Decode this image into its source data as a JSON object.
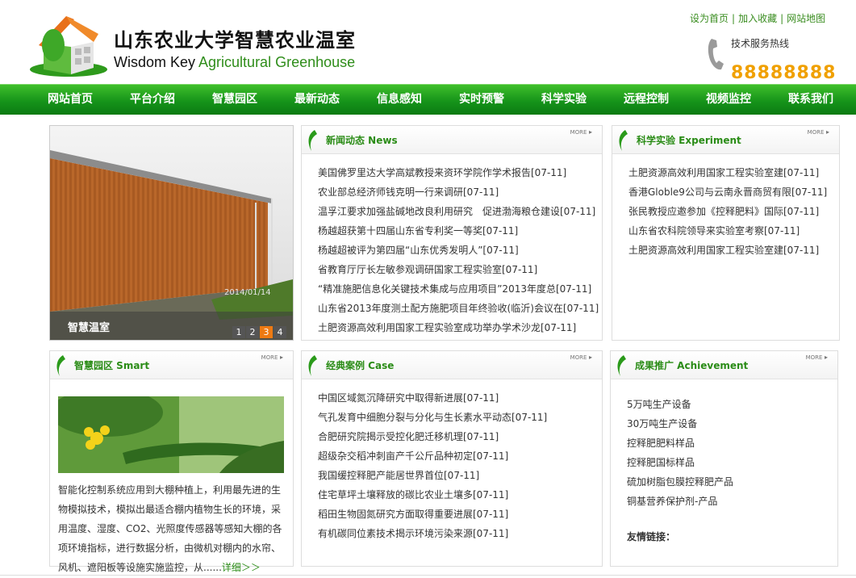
{
  "header": {
    "title_cn": "山东农业大学智慧农业温室",
    "title_en_part1": "Wisdom Key ",
    "title_en_part2": "Agricultural Greenhouse",
    "links": [
      "设为首页",
      "加入收藏",
      "网站地图"
    ],
    "hotline_label": "技术服务热线",
    "hotline_number": "88888888"
  },
  "nav": [
    "网站首页",
    "平台介绍",
    "智慧园区",
    "最新动态",
    "信息感知",
    "实时预警",
    "科学实验",
    "远程控制",
    "视频监控",
    "联系我们"
  ],
  "banner": {
    "caption": "智慧温室",
    "stamp": "2014/01/14",
    "pages": [
      "1",
      "2",
      "3",
      "4"
    ],
    "active_page": "3"
  },
  "news": {
    "title": "新闻动态 News",
    "more": "MORE",
    "items": [
      "美国佛罗里达大学高斌教授来资环学院作学术报告[07-11]",
      "农业部总经济师钱克明一行来调研[07-11]",
      "温孚江要求加强盐碱地改良利用研究　促进渤海粮仓建设[07-11]",
      "杨越超获第十四届山东省专利奖一等奖[07-11]",
      "杨越超被评为第四届“山东优秀发明人”[07-11]",
      "省教育厅厅长左敏参观调研国家工程实验室[07-11]",
      "“精准施肥信息化关键技术集成与应用项目”2013年度总[07-11]",
      "山东省2013年度测土配方施肥项目年终验收(临沂)会议在[07-11]",
      "土肥资源高效利用国家工程实验室成功举办学术沙龙[07-11]"
    ]
  },
  "experiment": {
    "title": "科学实验 Experiment",
    "more": "MORE",
    "items": [
      "土肥资源高效利用国家工程实验室建[07-11]",
      "香港Globle9公司与云南永晋商贸有限[07-11]",
      "张民教授应邀参加《控释肥料》国际[07-11]",
      "山东省农科院领导来实验室考察[07-11]",
      "土肥资源高效利用国家工程实验室建[07-11]"
    ]
  },
  "smart": {
    "title": "智慧园区 Smart",
    "more": "MORE",
    "text": "智能化控制系统应用到大棚种植上，利用最先进的生物模拟技术，模拟出最适合棚内植物生长的环境，采用温度、湿度、CO2、光照度传感器等感知大棚的各项环境指标，进行数据分析，由微机对棚内的水帘、风机、遮阳板等设施实施监控，从......",
    "detail": "详细＞＞"
  },
  "cases": {
    "title": "经典案例 Case",
    "more": "MORE",
    "items": [
      "中国区域氮沉降研究中取得新进展[07-11]",
      "气孔发育中细胞分裂与分化与生长素水平动态[07-11]",
      "合肥研究院揭示受控化肥迁移机理[07-11]",
      "超级杂交稻冲刺亩产千公斤品种初定[07-11]",
      "我国缓控释肥产能居世界首位[07-11]",
      "住宅草坪土壤释放的碳比农业土壤多[07-11]",
      "稻田生物固氮研究方面取得重要进展[07-11]",
      "有机碳同位素技术揭示环境污染来源[07-11]"
    ]
  },
  "achievement": {
    "title": "成果推广 Achievement",
    "more": "MORE",
    "items": [
      "5万吨生产设备",
      "30万吨生产设备",
      "控释肥肥料样品",
      "控释肥国标样品",
      "硫加树脂包膜控释肥产品",
      "铜基营养保护剂-产品"
    ],
    "friend_links": "友情链接："
  },
  "colors": {
    "brand_green": "#2a8c16",
    "nav_green": "#16941a",
    "hotline_orange": "#f0a000",
    "pager_active": "#ee7a12"
  }
}
